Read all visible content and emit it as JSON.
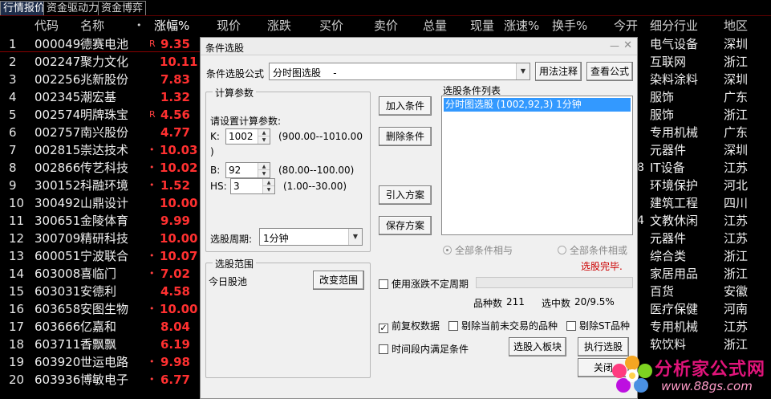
{
  "tabs": [
    "行情报价",
    "资金驱动力",
    "资金博弈"
  ],
  "columns": {
    "code": "代码",
    "name": "名称",
    "dot": "•",
    "pct": "涨幅%",
    "now": "现价",
    "chg": "涨跌",
    "bid": "买价",
    "ask": "卖价",
    "vol": "总量",
    "cur": "现量",
    "speed": "涨速%",
    "turnover": "换手%",
    "open": "今开",
    "industry": "细分行业",
    "region": "地区"
  },
  "rows": [
    {
      "idx": "1",
      "code": "000049",
      "name": "德赛电池",
      "mark": "R",
      "pct": "9.35",
      "cut": "",
      "industry": "电气设备",
      "region": "深圳"
    },
    {
      "idx": "2",
      "code": "002247",
      "name": "聚力文化",
      "mark": "",
      "pct": "10.11",
      "cut": "",
      "industry": "互联网",
      "region": "浙江"
    },
    {
      "idx": "3",
      "code": "002256",
      "name": "兆新股份",
      "mark": "",
      "pct": "7.83",
      "cut": "",
      "industry": "染料涂料",
      "region": "深圳"
    },
    {
      "idx": "4",
      "code": "002345",
      "name": "潮宏基",
      "mark": "",
      "pct": "1.32",
      "cut": "",
      "industry": "服饰",
      "region": "广东"
    },
    {
      "idx": "5",
      "code": "002574",
      "name": "明牌珠宝",
      "mark": "R",
      "pct": "4.56",
      "cut": "",
      "industry": "服饰",
      "region": "浙江"
    },
    {
      "idx": "6",
      "code": "002757",
      "name": "南兴股份",
      "mark": "",
      "pct": "4.77",
      "cut": "",
      "industry": "专用机械",
      "region": "广东"
    },
    {
      "idx": "7",
      "code": "002815",
      "name": "崇达技术",
      "mark": "•",
      "pct": "10.03",
      "cut": "",
      "industry": "元器件",
      "region": "深圳"
    },
    {
      "idx": "8",
      "code": "002866",
      "name": "传艺科技",
      "mark": "•",
      "pct": "10.02",
      "cut": "8",
      "industry": "IT设备",
      "region": "江苏"
    },
    {
      "idx": "9",
      "code": "300152",
      "name": "科融环境",
      "mark": "•",
      "pct": "1.52",
      "cut": "",
      "industry": "环境保护",
      "region": "河北"
    },
    {
      "idx": "10",
      "code": "300492",
      "name": "山鼎设计",
      "mark": "",
      "pct": "10.00",
      "cut": "",
      "industry": "建筑工程",
      "region": "四川"
    },
    {
      "idx": "11",
      "code": "300651",
      "name": "金陵体育",
      "mark": "",
      "pct": "9.99",
      "cut": "4",
      "industry": "文教休闲",
      "region": "江苏"
    },
    {
      "idx": "12",
      "code": "300709",
      "name": "精研科技",
      "mark": "",
      "pct": "10.00",
      "cut": "",
      "industry": "元器件",
      "region": "江苏"
    },
    {
      "idx": "13",
      "code": "600051",
      "name": "宁波联合",
      "mark": "•",
      "pct": "10.07",
      "cut": "",
      "industry": "综合类",
      "region": "浙江"
    },
    {
      "idx": "14",
      "code": "603008",
      "name": "喜临门",
      "mark": "•",
      "pct": "7.02",
      "cut": "",
      "industry": "家居用品",
      "region": "浙江"
    },
    {
      "idx": "15",
      "code": "603031",
      "name": "安德利",
      "mark": "",
      "pct": "4.58",
      "cut": "",
      "industry": "百货",
      "region": "安徽"
    },
    {
      "idx": "16",
      "code": "603658",
      "name": "安图生物",
      "mark": "•",
      "pct": "10.00",
      "cut": "",
      "industry": "医疗保健",
      "region": "河南"
    },
    {
      "idx": "17",
      "code": "603666",
      "name": "亿嘉和",
      "mark": "",
      "pct": "8.04",
      "cut": "",
      "industry": "专用机械",
      "region": "江苏"
    },
    {
      "idx": "18",
      "code": "603711",
      "name": "香飘飘",
      "mark": "",
      "pct": "6.19",
      "cut": "",
      "industry": "软饮料",
      "region": "浙江"
    },
    {
      "idx": "19",
      "code": "603920",
      "name": "世运电路",
      "mark": "•",
      "pct": "9.98",
      "cut": "",
      "industry": "",
      "region": ""
    },
    {
      "idx": "20",
      "code": "603936",
      "name": "博敏电子",
      "mark": "•",
      "pct": "6.77",
      "cut": "",
      "industry": "",
      "region": ""
    }
  ],
  "dialog": {
    "title": "条件选股",
    "minimize": "—",
    "close": "✕",
    "formula_label": "条件选股公式",
    "formula_value": "分时图选股    -",
    "usage_btn": "用法注释",
    "view_btn": "查看公式",
    "calc_group": "计算参数",
    "calc_prompt": "请设置计算参数:",
    "params": [
      {
        "name": "K:",
        "value": "1002",
        "range": "(900.00--1010.00",
        "range2": ")"
      },
      {
        "name": "B:",
        "value": "92",
        "range": "(80.00--100.00)",
        "range2": ""
      },
      {
        "name": "HS:",
        "value": "3",
        "range": "(1.00--30.00)",
        "range2": ""
      }
    ],
    "period_label": "选股周期:",
    "period_value": "1分钟",
    "scope_group": "选股范围",
    "scope_value": "今日股池",
    "change_scope_btn": "改变范围",
    "add_btn": "加入条件",
    "del_btn": "删除条件",
    "import_btn": "引入方案",
    "save_btn": "保存方案",
    "cond_list_label": "选股条件列表",
    "cond_items": [
      "分时图选股 (1002,92,3) 1分钟"
    ],
    "radio_all_and": "全部条件相与",
    "radio_all_or": "全部条件相或",
    "status_done": "选股完毕.",
    "use_period_label": "使用涨跌不定周期",
    "count_label": "品种数",
    "count_value": "211",
    "selected_label": "选中数",
    "selected_value": "20/9.5%",
    "fq_label": "前复权数据",
    "exclude_label": "剔除当前未交易的品种",
    "exclude_st_label": "剔除ST品种",
    "time_label": "时间段内满足条件",
    "to_block_btn": "选股入板块",
    "run_btn": "执行选股",
    "close_btn": "关闭"
  },
  "watermark": {
    "title": "分析家公式网",
    "url": "www.88gs.com"
  }
}
